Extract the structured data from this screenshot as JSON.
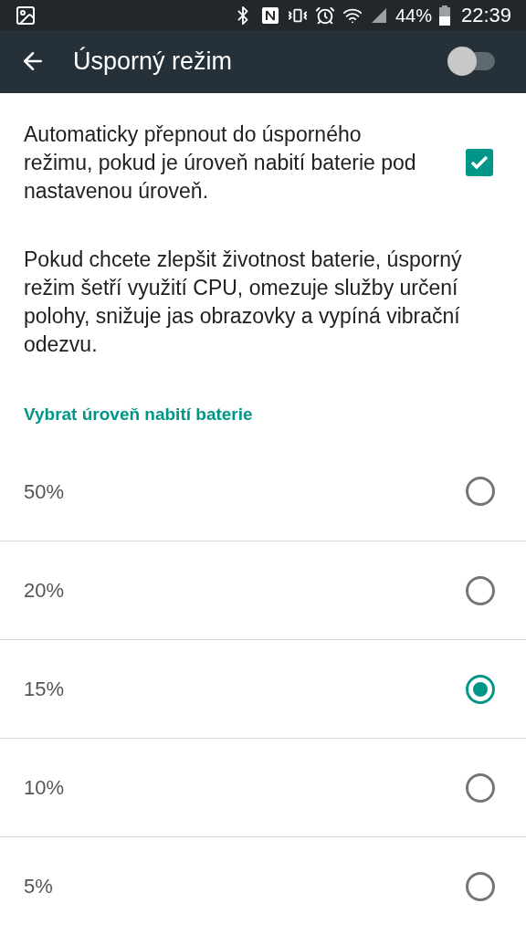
{
  "status_bar": {
    "battery_percent": "44%",
    "time": "22:39"
  },
  "toolbar": {
    "title": "Úsporný režim",
    "switch_on": false
  },
  "auto_switch": {
    "text": "Automaticky přepnout do úsporného režimu, pokud je úroveň nabití baterie pod nastavenou úroveň.",
    "checked": true
  },
  "description": "Pokud chcete zlepšit životnost baterie, úsporný režim šetří využití CPU, omezuje služby určení polohy, snižuje jas obrazovky a vypíná vibrační odezvu.",
  "section_title": "Vybrat úroveň nabití baterie",
  "levels": [
    {
      "label": "50%",
      "selected": false
    },
    {
      "label": "20%",
      "selected": false
    },
    {
      "label": "15%",
      "selected": true
    },
    {
      "label": "10%",
      "selected": false
    },
    {
      "label": "5%",
      "selected": false
    }
  ]
}
